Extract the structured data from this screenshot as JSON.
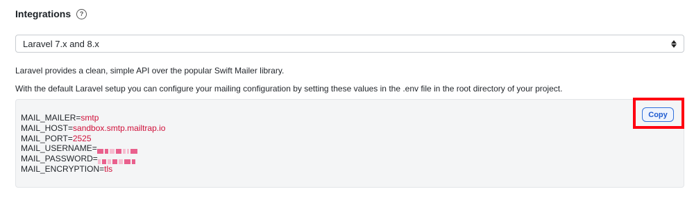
{
  "integrations": {
    "title": "Integrations",
    "help_icon": "?"
  },
  "framework_select": {
    "selected": "Laravel 7.x and 8.x"
  },
  "description": {
    "line1": "Laravel provides a clean, simple API over the popular Swift Mailer library.",
    "line2": "With the default Laravel setup you can configure your mailing configuration by setting these values in the .env file in the root directory of your project."
  },
  "config": {
    "mailer_key": "MAIL_MAILER=",
    "mailer_val": "smtp",
    "host_key": "MAIL_HOST=",
    "host_val": "sandbox.smtp.mailtrap.io",
    "port_key": "MAIL_PORT=",
    "port_val": "2525",
    "username_key": "MAIL_USERNAME=",
    "password_key": "MAIL_PASSWORD=",
    "encryption_key": "MAIL_ENCRYPTION=",
    "encryption_val": "tls"
  },
  "copy_button": {
    "label": "Copy"
  },
  "colors": {
    "value_text": "#d0103a",
    "highlight": "#ff0010",
    "button_accent": "#2f6fdb"
  }
}
